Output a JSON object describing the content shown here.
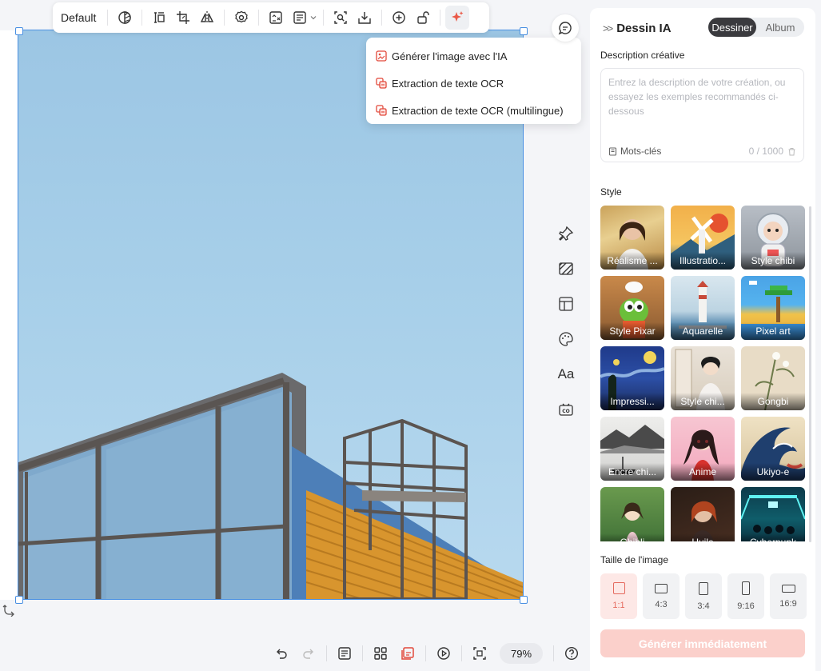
{
  "toolbar": {
    "preset_label": "Default",
    "icons": [
      "filter-icon",
      "align-top-icon",
      "crop-icon",
      "flip-icon",
      "settings-icon",
      "image-edit-icon",
      "text-doc-icon",
      "zoom-fit-icon",
      "download-icon",
      "add-circle-icon",
      "unlock-icon",
      "ai-sparkle-icon"
    ]
  },
  "dropdown": {
    "items": [
      {
        "label": "Générer l'image avec l'IA",
        "icon": "ai-image-icon"
      },
      {
        "label": "Extraction de texte OCR",
        "icon": "ocr-icon"
      },
      {
        "label": "Extraction de texte OCR (multilingue)",
        "icon": "ocr-multilingual-icon"
      }
    ]
  },
  "side_tools": {
    "text_label": "Aa",
    "icons": [
      "pin-icon",
      "pattern-icon",
      "layout-icon",
      "palette-icon",
      "text-icon",
      "cc-icon"
    ]
  },
  "bottom": {
    "zoom": "79%",
    "icons": [
      "undo-icon",
      "redo-icon",
      "notes-icon",
      "grid-icon",
      "layers-icon",
      "play-icon",
      "fit-screen-icon",
      "help-icon"
    ]
  },
  "panel": {
    "title": "Dessin IA",
    "tabs": [
      "Dessiner",
      "Album"
    ],
    "active_tab": 0,
    "description_label": "Description créative",
    "description_placeholder": "Entrez la description de votre création, ou essayez les exemples recommandés ci-dessous",
    "keywords_label": "Mots-clés",
    "counter": "0 / 1000",
    "style_label": "Style",
    "styles": [
      {
        "name": "Réalisme ..."
      },
      {
        "name": "Illustratio..."
      },
      {
        "name": "Style chibi"
      },
      {
        "name": "Style Pixar"
      },
      {
        "name": "Aquarelle"
      },
      {
        "name": "Pixel art"
      },
      {
        "name": "Impressi..."
      },
      {
        "name": "Style chi..."
      },
      {
        "name": "Gongbi"
      },
      {
        "name": "Encre chi..."
      },
      {
        "name": "Anime"
      },
      {
        "name": "Ukiyo-e"
      },
      {
        "name": "Ghibli"
      },
      {
        "name": "Huile"
      },
      {
        "name": "Cyberpunk"
      }
    ],
    "size_label": "Taille de l'image",
    "sizes": [
      "1:1",
      "4:3",
      "3:4",
      "9:16",
      "16:9"
    ],
    "active_size": 0,
    "generate_label": "Générer immédiatement",
    "colors": {
      "accent": "#e56a5e",
      "generate_bg": "#fbd0cb",
      "selection": "#4a90e2"
    }
  }
}
